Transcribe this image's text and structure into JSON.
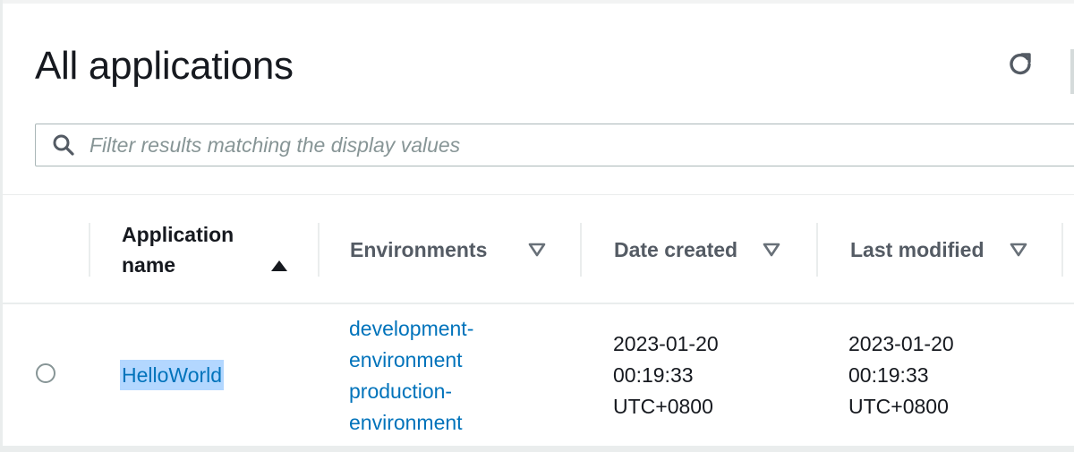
{
  "page": {
    "title": "All applications"
  },
  "filter": {
    "placeholder": "Filter results matching the display values",
    "value": ""
  },
  "table": {
    "columns": [
      {
        "label": "Application name",
        "sort": "ascending"
      },
      {
        "label": "Environments",
        "sort": "none"
      },
      {
        "label": "Date created",
        "sort": "none"
      },
      {
        "label": "Last modified",
        "sort": "none"
      }
    ],
    "rows": [
      {
        "application_name": "HelloWorld",
        "environments": [
          "development-environment",
          "production-environment"
        ],
        "environments_lines": [
          "development-",
          "environment",
          "production-",
          "environment"
        ],
        "date_created_lines": [
          "2023-01-20",
          "00:19:33",
          "UTC+0800"
        ],
        "last_modified_lines": [
          "2023-01-20",
          "00:19:33",
          "UTC+0800"
        ]
      }
    ]
  },
  "icons": {
    "refresh": "refresh-icon",
    "search": "search-icon",
    "sort_ascending": "sort-ascending-icon",
    "sort_descending": "sort-descending-icon"
  },
  "colors": {
    "link": "#0073bb",
    "text": "#16191f",
    "header_text": "#545b64",
    "selection": "#b3d7ff",
    "border": "#aab7b8"
  }
}
